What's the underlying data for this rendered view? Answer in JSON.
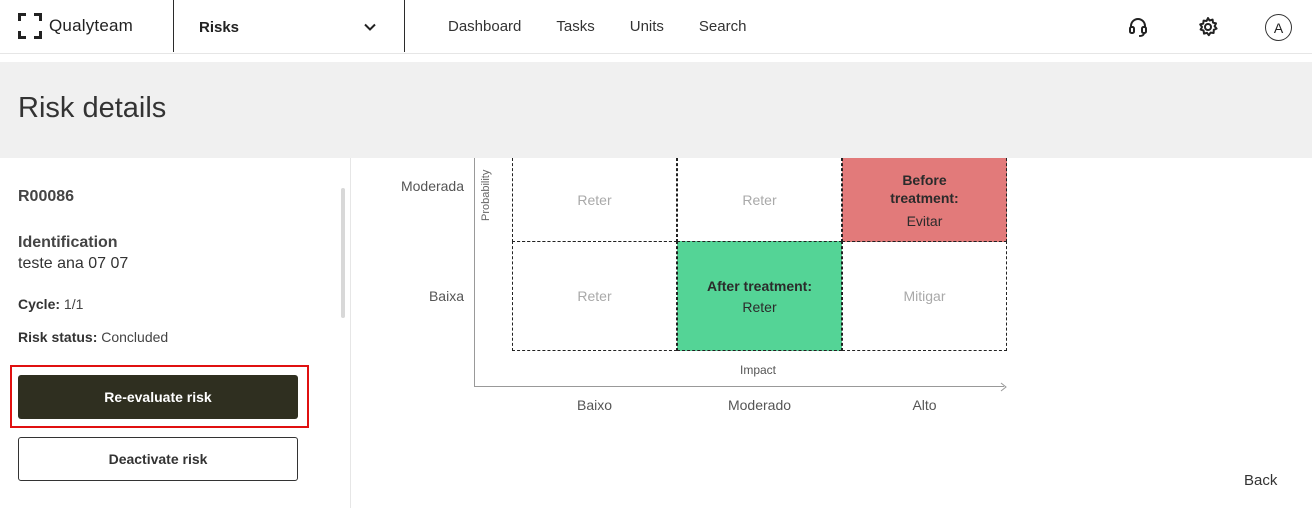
{
  "app": {
    "logo_text": "Qualyteam",
    "module": "Risks",
    "nav": [
      "Dashboard",
      "Tasks",
      "Units",
      "Search"
    ],
    "avatar_initial": "A",
    "icons": [
      "headset-icon",
      "gear-icon",
      "chevron-down-icon"
    ]
  },
  "page": {
    "title": "Risk details"
  },
  "risk": {
    "code": "R00086",
    "identification_label": "Identification",
    "identification_value": "teste ana 07 07",
    "cycle_label": "Cycle:",
    "cycle_value": "1/1",
    "status_label": "Risk status:",
    "status_value": "Concluded",
    "reevaluate_button": "Re-evaluate risk",
    "deactivate_button": "Deactivate risk"
  },
  "matrix": {
    "y_axis_title": "Probability",
    "x_axis_title": "Impact",
    "rows": [
      "Moderada",
      "Baixa"
    ],
    "columns": [
      "Baixo",
      "Moderado",
      "Alto"
    ],
    "cells": {
      "moderada_baixo": "Reter",
      "moderada_moderado": "Reter",
      "moderada_alto_tag": "Before treatment:",
      "moderada_alto_value": "Evitar",
      "baixa_baixo": "Reter",
      "baixa_moderado_tag": "After treatment:",
      "baixa_moderado_value": "Reter",
      "baixa_alto": "Mitigar"
    },
    "colors": {
      "before_treatment": "#e27a7a",
      "after_treatment": "#54d496"
    }
  },
  "footer": {
    "back_label": "Back"
  }
}
